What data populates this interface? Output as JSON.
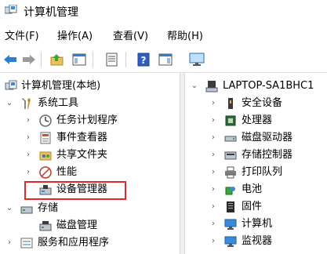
{
  "window": {
    "title": "计算机管理"
  },
  "menu": [
    {
      "label": "文件(F)"
    },
    {
      "label": "操作(A)"
    },
    {
      "label": "查看(V)"
    },
    {
      "label": "帮助(H)"
    }
  ],
  "toolbar": {
    "buttons": [
      {
        "icon": "back-arrow-icon"
      },
      {
        "icon": "forward-arrow-icon"
      },
      {
        "icon": "up-folder-icon"
      },
      {
        "icon": "show-hide-tree-icon"
      },
      {
        "icon": "properties-icon"
      },
      {
        "icon": "help-icon"
      },
      {
        "icon": "action-pane-icon"
      },
      {
        "icon": "monitor-icon"
      }
    ]
  },
  "left_tree": {
    "root": "计算机管理(本地)",
    "items": [
      {
        "label": "系统工具",
        "expanded": true
      },
      {
        "label": "任务计划程序"
      },
      {
        "label": "事件查看器"
      },
      {
        "label": "共享文件夹"
      },
      {
        "label": "性能"
      },
      {
        "label": "设备管理器",
        "selected": true
      },
      {
        "label": "存储",
        "expanded": true
      },
      {
        "label": "磁盘管理"
      },
      {
        "label": "服务和应用程序"
      }
    ]
  },
  "right_tree": {
    "root": "LAPTOP-SA1BHC1",
    "items": [
      {
        "label": "安全设备"
      },
      {
        "label": "处理器"
      },
      {
        "label": "磁盘驱动器"
      },
      {
        "label": "存储控制器"
      },
      {
        "label": "打印队列"
      },
      {
        "label": "电池"
      },
      {
        "label": "固件"
      },
      {
        "label": "计算机"
      },
      {
        "label": "监视器"
      }
    ]
  },
  "colors": {
    "highlight_border": "#e8262a",
    "accent_blue": "#1e73d6"
  }
}
